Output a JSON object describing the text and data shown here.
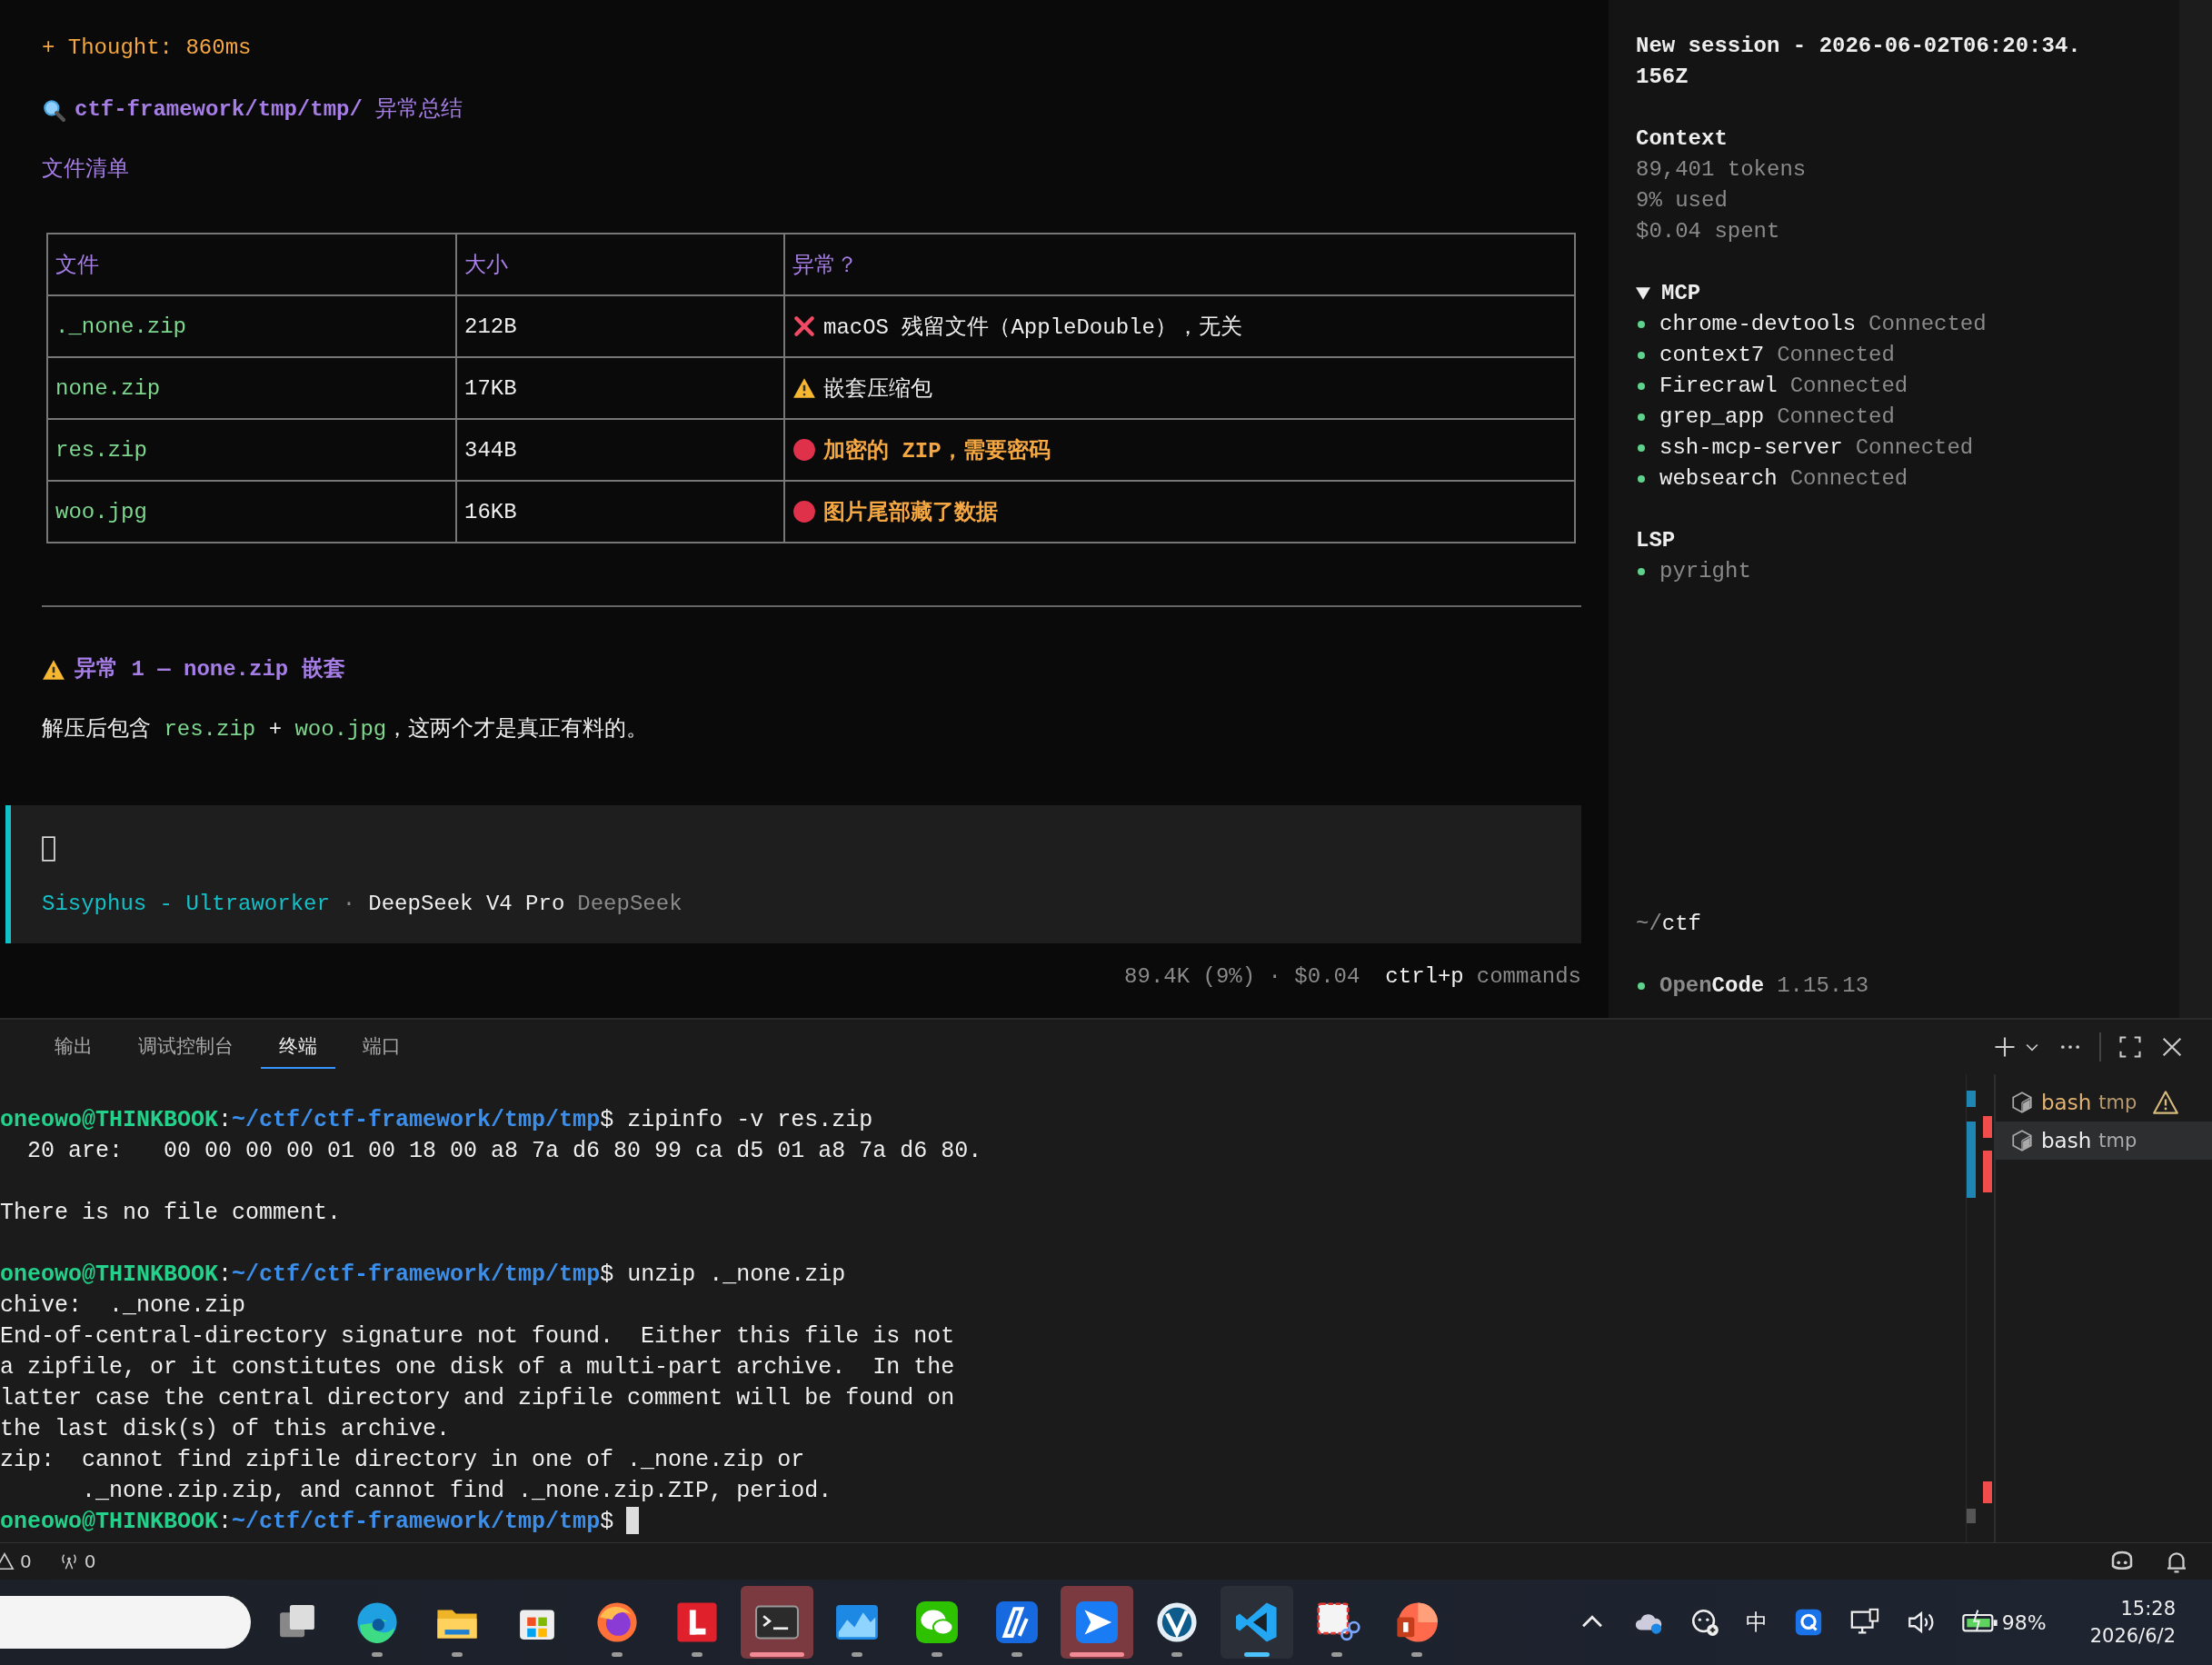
{
  "chat": {
    "thought": "+ Thought: 860ms",
    "heading": "**ctf-framework/tmp/tmp/** 异常总结",
    "subheading": "文件清单",
    "table": {
      "columns": [
        "文件",
        "大小",
        "异常？"
      ],
      "rows": [
        {
          "file": "._none.zip",
          "size": "212B",
          "note": "macOS 残留文件（AppleDouble），无关",
          "kind": "irrelevant"
        },
        {
          "file": "none.zip",
          "size": "17KB",
          "note": "嵌套压缩包",
          "kind": "warning"
        },
        {
          "file": "res.zip",
          "size": "344B",
          "note": "加密的 ZIP，需要密码",
          "kind": "critical"
        },
        {
          "file": "woo.jpg",
          "size": "16KB",
          "note": "图片尾部藏了数据",
          "kind": "critical"
        }
      ]
    },
    "section_heading": "异常 1 — none.zip 嵌套",
    "paragraph": [
      {
        "text": "解压后包含 ",
        "code": false
      },
      {
        "text": "res.zip",
        "code": true
      },
      {
        "text": " + ",
        "code": false
      },
      {
        "text": "woo.jpg",
        "code": true
      },
      {
        "text": "，这两个才是真正有料的。",
        "code": false
      }
    ]
  },
  "prompt": {
    "agent": "Sisyphus - Ultraworker",
    "separator": "·",
    "model": "DeepSeek V4 Pro",
    "provider": "DeepSeek"
  },
  "footer": {
    "usage": "89.4K (9%) · $0.04",
    "shortcut": "ctrl+p",
    "shortcut_label": "commands"
  },
  "sidebar": {
    "title": "New session - 2026-06-02T06:20:34.156Z",
    "context": {
      "heading": "Context",
      "lines": [
        "89,401 tokens",
        "9% used",
        "$0.04 spent"
      ]
    },
    "mcp": {
      "heading": "MCP",
      "expanded": true,
      "items": [
        {
          "name": "chrome-devtools",
          "status": "Connected"
        },
        {
          "name": "context7",
          "status": "Connected"
        },
        {
          "name": "Firecrawl",
          "status": "Connected"
        },
        {
          "name": "grep_app",
          "status": "Connected"
        },
        {
          "name": "ssh-mcp-server",
          "status": "Connected"
        },
        {
          "name": "websearch",
          "status": "Connected"
        }
      ]
    },
    "lsp": {
      "heading": "LSP",
      "items": [
        "pyright"
      ]
    },
    "cwd": {
      "prefix": "~/",
      "name": "ctf"
    },
    "app": {
      "name_dim": "Open",
      "name_bright": "Code",
      "version": "1.15.13"
    }
  },
  "panel": {
    "tabs": [
      {
        "label": "输出",
        "selected": false
      },
      {
        "label": "调试控制台",
        "selected": false
      },
      {
        "label": "终端",
        "selected": true
      },
      {
        "label": "端口",
        "selected": false
      }
    ],
    "terminal_lines": [
      {
        "kind": "prompt",
        "user": "oneowo@THINKBOOK",
        "colon": ":",
        "path": "~/ctf/ctf-framework/tmp/tmp",
        "dollar": "$",
        "command": " zipinfo -v res.zip",
        "cursor": false
      },
      {
        "kind": "output",
        "text": "  20 are:   00 00 00 00 01 00 18 00 a8 7a d6 80 99 ca d5 01 a8 7a d6 80."
      },
      {
        "kind": "blank"
      },
      {
        "kind": "output",
        "text": "There is no file comment."
      },
      {
        "kind": "blank"
      },
      {
        "kind": "prompt",
        "user": "oneowo@THINKBOOK",
        "colon": ":",
        "path": "~/ctf/ctf-framework/tmp/tmp",
        "dollar": "$",
        "command": " unzip ._none.zip",
        "cursor": false
      },
      {
        "kind": "output",
        "text": "chive:  ._none.zip"
      },
      {
        "kind": "output",
        "text": "End-of-central-directory signature not found.  Either this file is not"
      },
      {
        "kind": "output",
        "text": "a zipfile, or it constitutes one disk of a multi-part archive.  In the"
      },
      {
        "kind": "output",
        "text": "latter case the central directory and zipfile comment will be found on"
      },
      {
        "kind": "output",
        "text": "the last disk(s) of this archive."
      },
      {
        "kind": "output",
        "text": "zip:  cannot find zipfile directory in one of ._none.zip or"
      },
      {
        "kind": "output",
        "text": "      ._none.zip.zip, and cannot find ._none.zip.ZIP, period."
      },
      {
        "kind": "prompt",
        "user": "oneowo@THINKBOOK",
        "colon": ":",
        "path": "~/ctf/ctf-framework/tmp/tmp",
        "dollar": "$",
        "cursor": true
      }
    ],
    "terminals": [
      {
        "label": "bash",
        "detail": "tmp",
        "warning": true,
        "selected": false
      },
      {
        "label": "bash",
        "detail": "tmp",
        "warning": false,
        "selected": true
      }
    ]
  },
  "status_bar": {
    "warnings": "0",
    "ports": "0"
  },
  "taskbar": {
    "apps": [
      {
        "kind": "multitask",
        "running": false,
        "active": false,
        "flashing": false
      },
      {
        "kind": "edge",
        "running": true,
        "active": false,
        "flashing": false
      },
      {
        "kind": "folder",
        "running": true,
        "active": false,
        "flashing": false
      },
      {
        "kind": "store",
        "running": false,
        "active": false,
        "flashing": false
      },
      {
        "kind": "firefox",
        "running": true,
        "active": false,
        "flashing": false
      },
      {
        "kind": "red-square",
        "running": true,
        "active": false,
        "flashing": false
      },
      {
        "kind": "terminal",
        "running": true,
        "active": false,
        "flashing": true
      },
      {
        "kind": "chart",
        "running": true,
        "active": false,
        "flashing": false
      },
      {
        "kind": "chat",
        "running": true,
        "active": false,
        "flashing": false
      },
      {
        "kind": "pen",
        "running": true,
        "active": false,
        "flashing": false
      },
      {
        "kind": "plane",
        "running": true,
        "active": false,
        "flashing": true
      },
      {
        "kind": "check",
        "running": true,
        "active": false,
        "flashing": false
      },
      {
        "kind": "code",
        "running": true,
        "active": true,
        "flashing": false
      },
      {
        "kind": "snip",
        "running": true,
        "active": false,
        "flashing": false
      },
      {
        "kind": "slides",
        "running": true,
        "active": false,
        "flashing": false
      }
    ],
    "ime": "中",
    "battery": "98%",
    "time": "15:28",
    "date": "2026/6/2"
  }
}
